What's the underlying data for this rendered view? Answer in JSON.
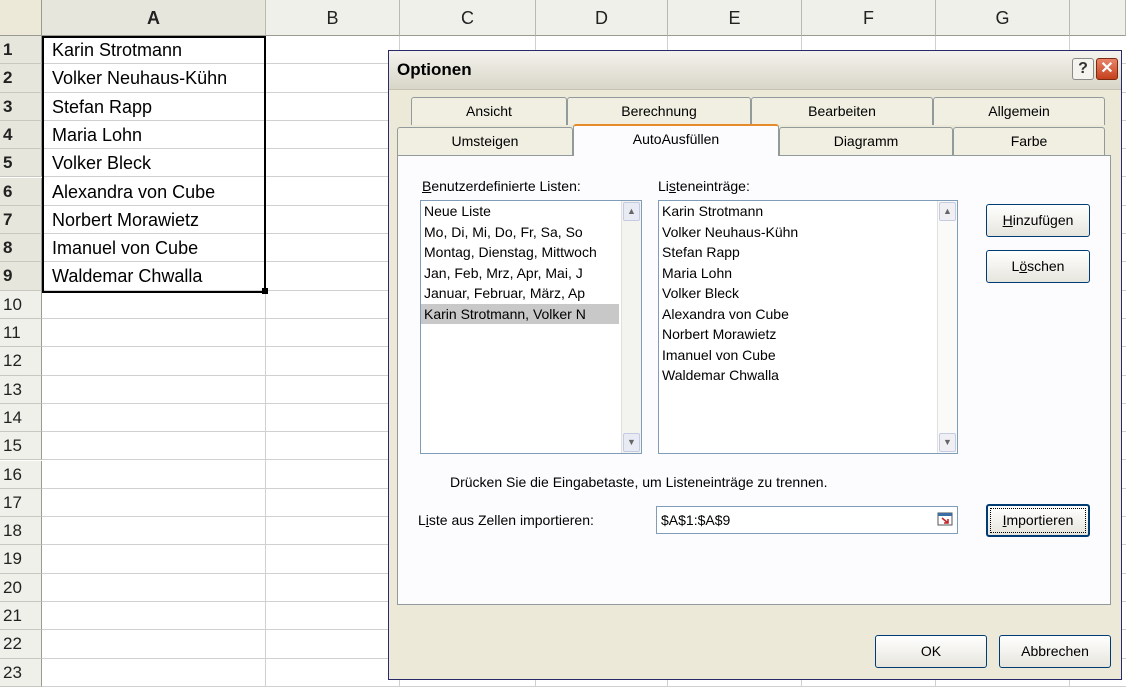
{
  "sheet": {
    "columns": [
      "A",
      "B",
      "C",
      "D",
      "E",
      "F",
      "G"
    ],
    "rows": [
      "1",
      "2",
      "3",
      "4",
      "5",
      "6",
      "7",
      "8",
      "9",
      "10",
      "11",
      "12",
      "13",
      "14",
      "15",
      "16",
      "17",
      "18",
      "19",
      "20",
      "21",
      "22",
      "23"
    ],
    "cells_a": [
      "Karin Strotmann",
      "Volker Neuhaus-Kühn",
      "Stefan Rapp",
      "Maria Lohn",
      "Volker Bleck",
      "Alexandra von Cube",
      "Norbert Morawietz",
      "Imanuel von Cube",
      "Waldemar Chwalla"
    ]
  },
  "dialog": {
    "title": "Optionen",
    "help_label": "?",
    "close_label": "✕",
    "tabs_back": [
      "Ansicht",
      "Berechnung",
      "Bearbeiten",
      "Allgemein"
    ],
    "tabs_front": [
      "Umsteigen",
      "AutoAusfüllen",
      "Diagramm",
      "Farbe"
    ],
    "active_tab": "AutoAusfüllen",
    "custom_lists_label_u": "B",
    "custom_lists_label_rest": "enutzerdefinierte Listen:",
    "custom_lists": [
      "Neue Liste",
      "Mo, Di, Mi, Do, Fr, Sa, So",
      "Montag, Dienstag, Mittwoch",
      "Jan, Feb, Mrz, Apr, Mai, J",
      "Januar, Februar, März, Ap",
      "Karin Strotmann, Volker N"
    ],
    "list_entries_label_pre": "Li",
    "list_entries_label_u": "s",
    "list_entries_label_rest": "teneinträge:",
    "list_entries": [
      "Karin Strotmann",
      "Volker Neuhaus-Kühn",
      "Stefan Rapp",
      "Maria Lohn",
      "Volker Bleck",
      "Alexandra von Cube",
      "Norbert Morawietz",
      "Imanuel von Cube",
      "Waldemar Chwalla"
    ],
    "add_button_u": "H",
    "add_button_rest": "inzufügen",
    "delete_button_pre": "L",
    "delete_button_u": "ö",
    "delete_button_rest": "schen",
    "hint": "Drücken Sie die Eingabetaste, um Listeneinträge zu trennen.",
    "import_label_pre": "L",
    "import_label_u": "i",
    "import_label_rest": "ste aus Zellen importieren:",
    "import_value": "$A$1:$A$9",
    "import_button_u": "I",
    "import_button_rest": "mportieren",
    "ok_label": "OK",
    "cancel_label": "Abbrechen",
    "colors": {
      "active_tab_accent": "#e68b2c",
      "selection": "#c8c8c8",
      "dialog_bg": "#ece9d8"
    }
  }
}
